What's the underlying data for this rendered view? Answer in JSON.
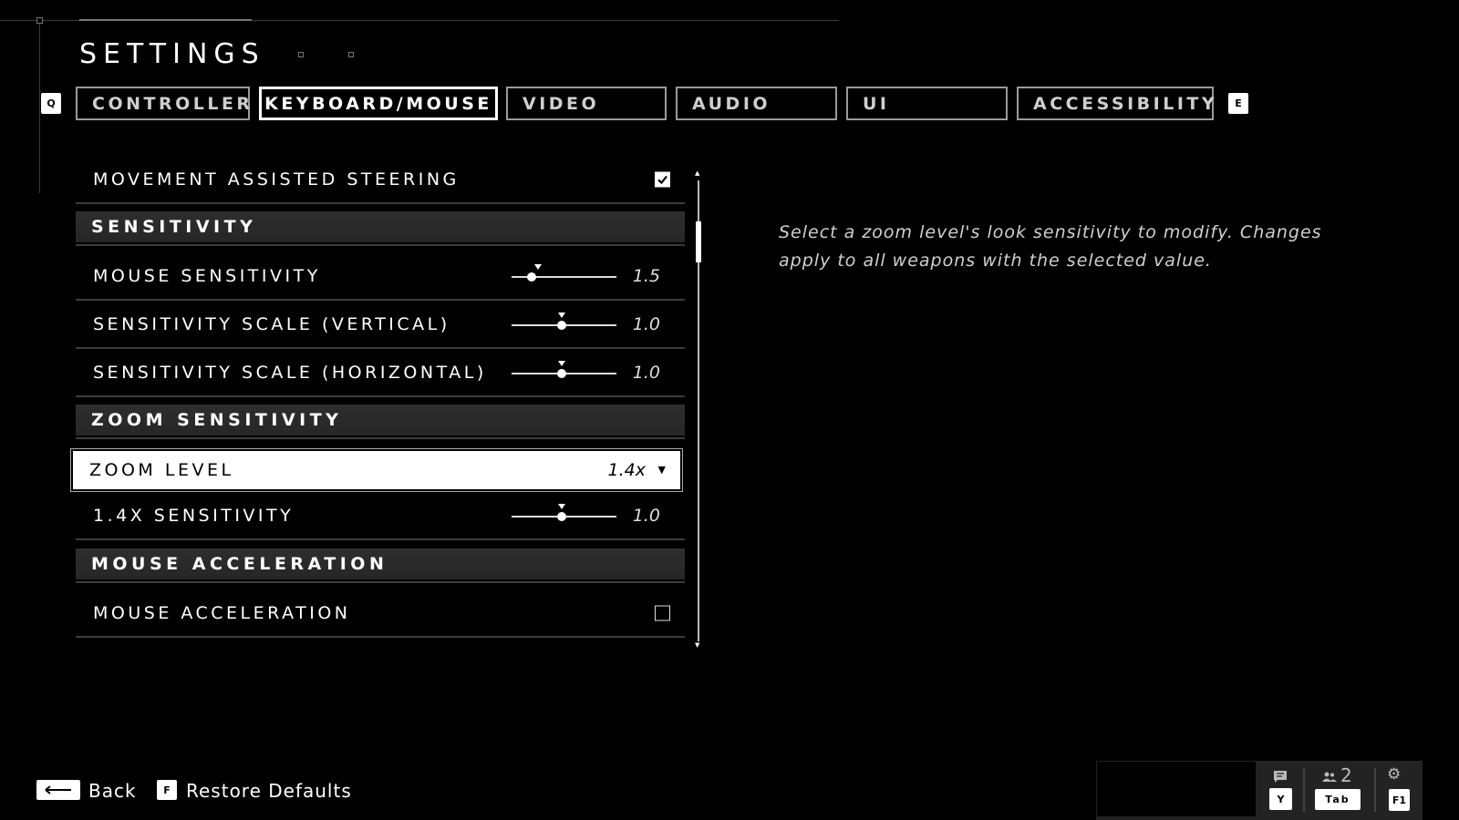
{
  "header": {
    "title": "SETTINGS",
    "prev_key": "Q",
    "next_key": "E"
  },
  "tabs": [
    {
      "label": "CONTROLLER",
      "active": false
    },
    {
      "label": "KEYBOARD/MOUSE",
      "active": true
    },
    {
      "label": "VIDEO",
      "active": false
    },
    {
      "label": "AUDIO",
      "active": false
    },
    {
      "label": "UI",
      "active": false
    },
    {
      "label": "ACCESSIBILITY",
      "active": false
    }
  ],
  "settings": {
    "movement_assisted_steering": {
      "label": "MOVEMENT ASSISTED STEERING",
      "checked": true
    },
    "sensitivity_header": "SENSITIVITY",
    "mouse_sensitivity": {
      "label": "MOUSE SENSITIVITY",
      "value": "1.5",
      "fraction": 0.19,
      "default_fraction": 0.25
    },
    "scale_vertical": {
      "label": "SENSITIVITY SCALE (VERTICAL)",
      "value": "1.0",
      "fraction": 0.48,
      "default_fraction": 0.48
    },
    "scale_horizontal": {
      "label": "SENSITIVITY SCALE (HORIZONTAL)",
      "value": "1.0",
      "fraction": 0.48,
      "default_fraction": 0.48
    },
    "zoom_header": "ZOOM SENSITIVITY",
    "zoom_level": {
      "label": "ZOOM LEVEL",
      "value": "1.4x"
    },
    "zoom_sensitivity": {
      "label": "1.4X SENSITIVITY",
      "value": "1.0",
      "fraction": 0.48,
      "default_fraction": 0.48
    },
    "accel_header": "MOUSE ACCELERATION",
    "mouse_acceleration": {
      "label": "MOUSE ACCELERATION",
      "checked": false
    }
  },
  "description": "Select a zoom level's look sensitivity to modify. Changes apply to all weapons with the selected value.",
  "footer": {
    "back_label": "Back",
    "restore_key": "F",
    "restore_label": "Restore Defaults"
  },
  "social": {
    "chat_key": "Y",
    "friends_count": "2",
    "friends_key": "Tab",
    "settings_key": "F1"
  }
}
